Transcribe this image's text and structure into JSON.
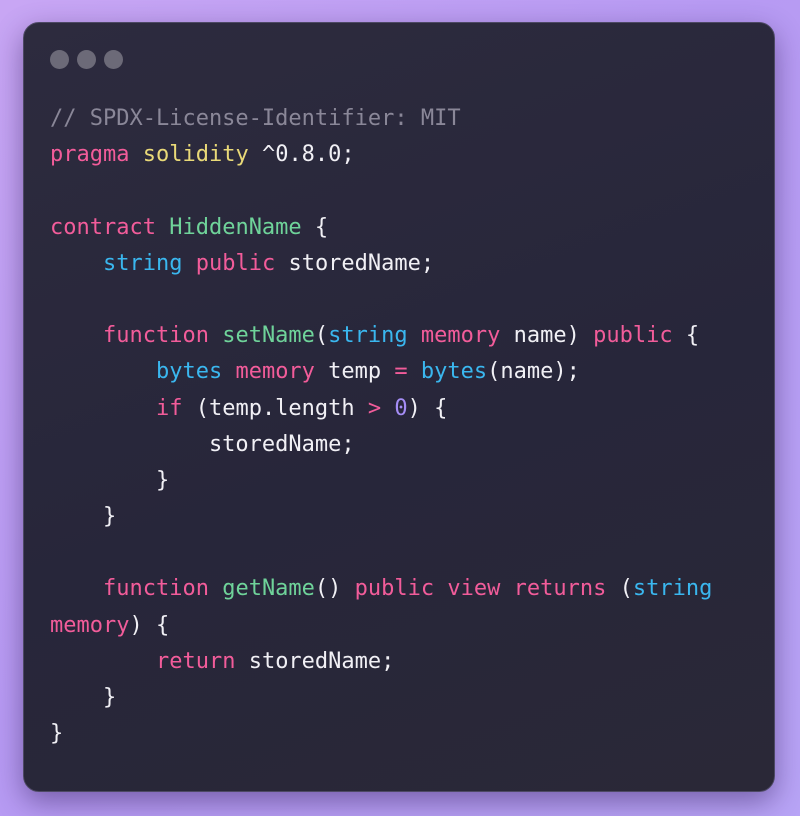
{
  "window": {
    "dots": [
      "window-dot",
      "window-dot",
      "window-dot"
    ]
  },
  "code": {
    "lines": [
      [
        {
          "t": "// SPDX-License-Identifier: MIT",
          "c": "comment"
        }
      ],
      [
        {
          "t": "pragma",
          "c": "kw"
        },
        {
          "t": " "
        },
        {
          "t": "solidity",
          "c": "yel"
        },
        {
          "t": " ^0.8.0;"
        }
      ],
      [],
      [
        {
          "t": "contract",
          "c": "kw"
        },
        {
          "t": " "
        },
        {
          "t": "HiddenName",
          "c": "fn"
        },
        {
          "t": " {"
        }
      ],
      [
        {
          "t": "    "
        },
        {
          "t": "string",
          "c": "type"
        },
        {
          "t": " "
        },
        {
          "t": "public",
          "c": "kw"
        },
        {
          "t": " storedName;"
        }
      ],
      [],
      [
        {
          "t": "    "
        },
        {
          "t": "function",
          "c": "kw"
        },
        {
          "t": " "
        },
        {
          "t": "setName",
          "c": "fn"
        },
        {
          "t": "("
        },
        {
          "t": "string",
          "c": "type"
        },
        {
          "t": " "
        },
        {
          "t": "memory",
          "c": "kw"
        },
        {
          "t": " name) "
        },
        {
          "t": "public",
          "c": "kw"
        },
        {
          "t": " {"
        }
      ],
      [
        {
          "t": "        "
        },
        {
          "t": "bytes",
          "c": "type"
        },
        {
          "t": " "
        },
        {
          "t": "memory",
          "c": "kw"
        },
        {
          "t": " temp "
        },
        {
          "t": "=",
          "c": "kw"
        },
        {
          "t": " "
        },
        {
          "t": "bytes",
          "c": "type"
        },
        {
          "t": "(name);"
        }
      ],
      [
        {
          "t": "        "
        },
        {
          "t": "if",
          "c": "kw"
        },
        {
          "t": " (temp.length "
        },
        {
          "t": ">",
          "c": "kw"
        },
        {
          "t": " "
        },
        {
          "t": "0",
          "c": "num"
        },
        {
          "t": ") {"
        }
      ],
      [
        {
          "t": "            storedName;"
        }
      ],
      [
        {
          "t": "        }"
        }
      ],
      [
        {
          "t": "    }"
        }
      ],
      [],
      [
        {
          "t": "    "
        },
        {
          "t": "function",
          "c": "kw"
        },
        {
          "t": " "
        },
        {
          "t": "getName",
          "c": "fn"
        },
        {
          "t": "() "
        },
        {
          "t": "public",
          "c": "kw"
        },
        {
          "t": " "
        },
        {
          "t": "view",
          "c": "kw"
        },
        {
          "t": " "
        },
        {
          "t": "returns",
          "c": "kw"
        },
        {
          "t": " ("
        },
        {
          "t": "string",
          "c": "type"
        }
      ],
      [
        {
          "t": "memory",
          "c": "kw"
        },
        {
          "t": ") {"
        }
      ],
      [
        {
          "t": "        "
        },
        {
          "t": "return",
          "c": "kw"
        },
        {
          "t": " storedName;"
        }
      ],
      [
        {
          "t": "    }"
        }
      ],
      [
        {
          "t": "}"
        }
      ]
    ]
  },
  "colors": {
    "keyword": "#f25c9a",
    "type": "#3ab7ef",
    "function_name": "#6fd39a",
    "solidity": "#e9d978",
    "number": "#a58df5",
    "comment": "#8a8798",
    "text": "#f1f0f5",
    "background": "#2b293b"
  }
}
